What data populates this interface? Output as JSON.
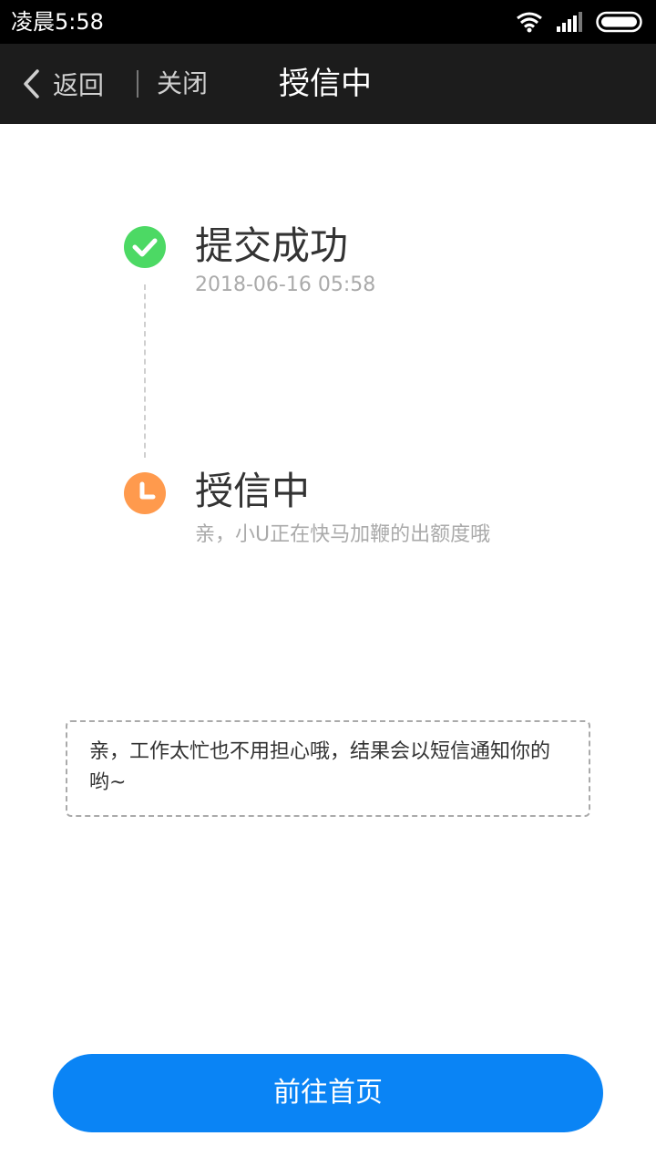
{
  "status_bar": {
    "time": "凌晨5:58",
    "icons": [
      "wifi-icon",
      "signal-icon",
      "battery-icon"
    ]
  },
  "nav": {
    "back_label": "返回",
    "close_label": "关闭",
    "title": "授信中"
  },
  "steps": [
    {
      "icon": "check-icon",
      "title": "提交成功",
      "subtitle": "2018-06-16 05:58",
      "color": "#4cd964"
    },
    {
      "icon": "clock-icon",
      "title": "授信中",
      "subtitle": "亲，小U正在快马加鞭的出额度哦",
      "color": "#ff9a4d"
    }
  ],
  "notice": {
    "text": "亲，工作太忙也不用担心哦，结果会以短信通知你的哟~"
  },
  "home_button": {
    "label": "前往首页",
    "color": "#0a84f5"
  }
}
